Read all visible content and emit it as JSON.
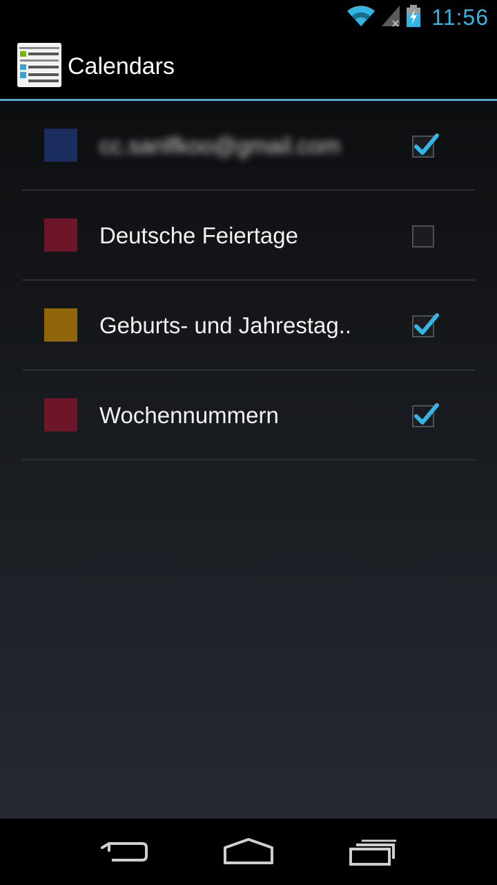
{
  "status_bar": {
    "time": "11:56",
    "icons": [
      "wifi-icon",
      "signal-icon",
      "battery-charging-icon"
    ],
    "accent_color": "#33b5e5"
  },
  "action_bar": {
    "title": "Calendars",
    "icon": "calendar-list-icon"
  },
  "calendars": [
    {
      "name": "cc.sanlfkoo@gmail.com",
      "color": "#1b2d5f",
      "checked": true,
      "blurred": true
    },
    {
      "name": "Deutsche Feiertage",
      "color": "#6e1629",
      "checked": false,
      "blurred": false
    },
    {
      "name": "Geburts- und Jahrestag..",
      "color": "#8f6609",
      "checked": true,
      "blurred": false
    },
    {
      "name": "Wochennummern",
      "color": "#6e1629",
      "checked": true,
      "blurred": false
    }
  ],
  "nav_bar": {
    "buttons": [
      "back-icon",
      "home-icon",
      "recent-apps-icon"
    ]
  }
}
